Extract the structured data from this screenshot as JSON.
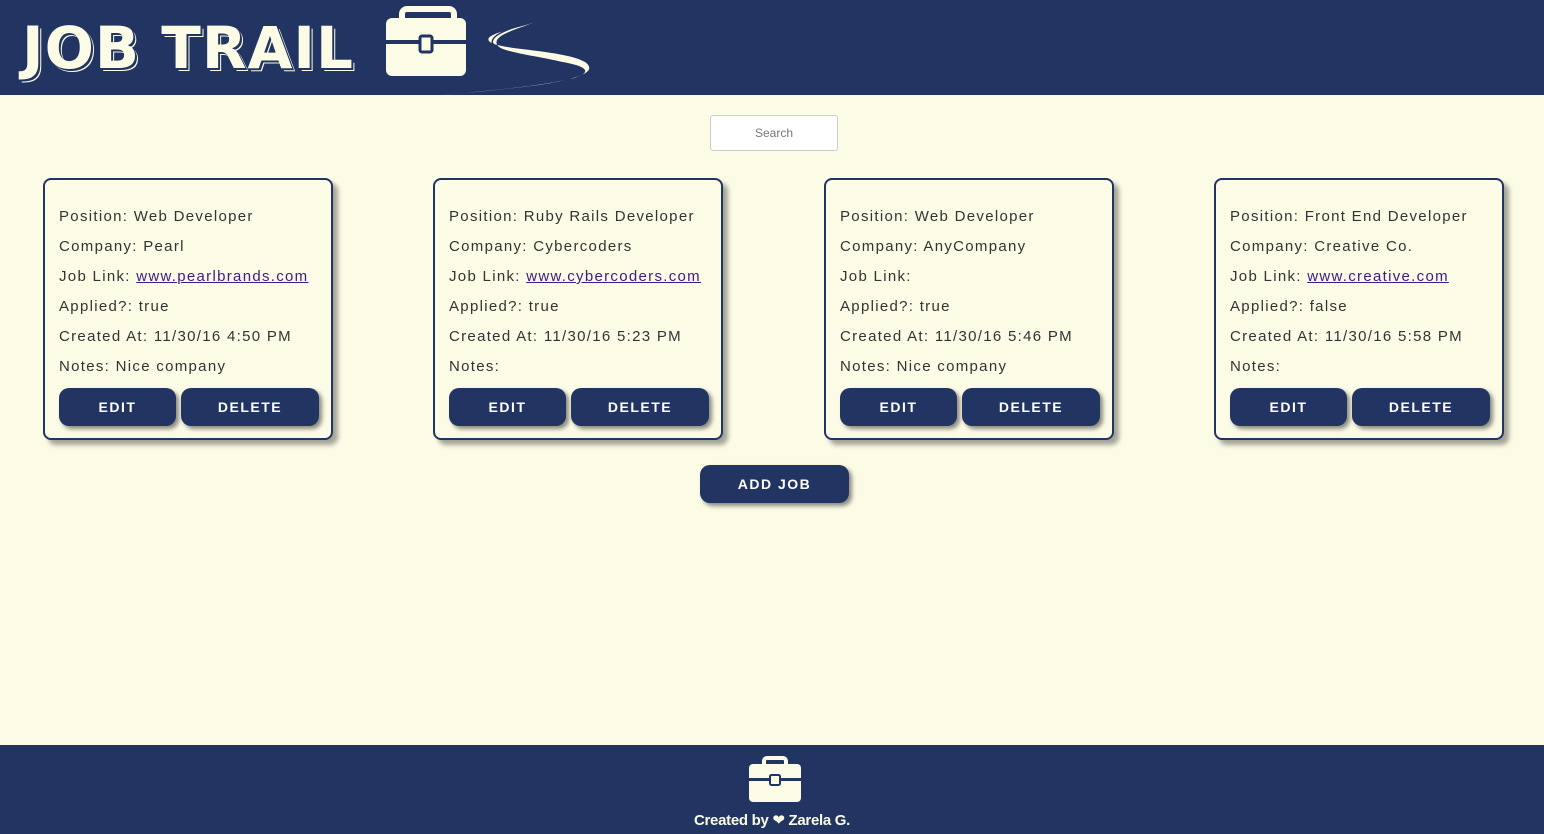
{
  "header": {
    "logo_text": "JOB TRAIL"
  },
  "search": {
    "placeholder": "Search"
  },
  "labels": {
    "position": "Position: ",
    "company": "Company: ",
    "job_link": "Job Link: ",
    "applied": "Applied?: ",
    "created_at": "Created At: ",
    "notes": "Notes: ",
    "edit": "EDIT",
    "delete": "DELETE"
  },
  "jobs": [
    {
      "position": "Web Developer",
      "company": "Pearl",
      "link": "www.pearlbrands.com",
      "applied": "true",
      "created_at": "11/30/16 4:50 PM",
      "notes": "Nice company"
    },
    {
      "position": "Ruby Rails Developer",
      "company": "Cybercoders",
      "link": "www.cybercoders.com",
      "applied": "true",
      "created_at": "11/30/16 5:23 PM",
      "notes": ""
    },
    {
      "position": "Web Developer",
      "company": "AnyCompany",
      "link": "",
      "applied": "true",
      "created_at": "11/30/16 5:46 PM",
      "notes": "Nice company"
    },
    {
      "position": "Front End Developer",
      "company": "Creative Co.",
      "link": "www.creative.com",
      "applied": "false",
      "created_at": "11/30/16 5:58 PM",
      "notes": ""
    }
  ],
  "add_job_label": "ADD JOB",
  "footer": {
    "text": "Created by ❤ Zarela G."
  },
  "colors": {
    "navy": "#213462",
    "cream": "#fcfbe6",
    "link": "#3d1a8a"
  }
}
